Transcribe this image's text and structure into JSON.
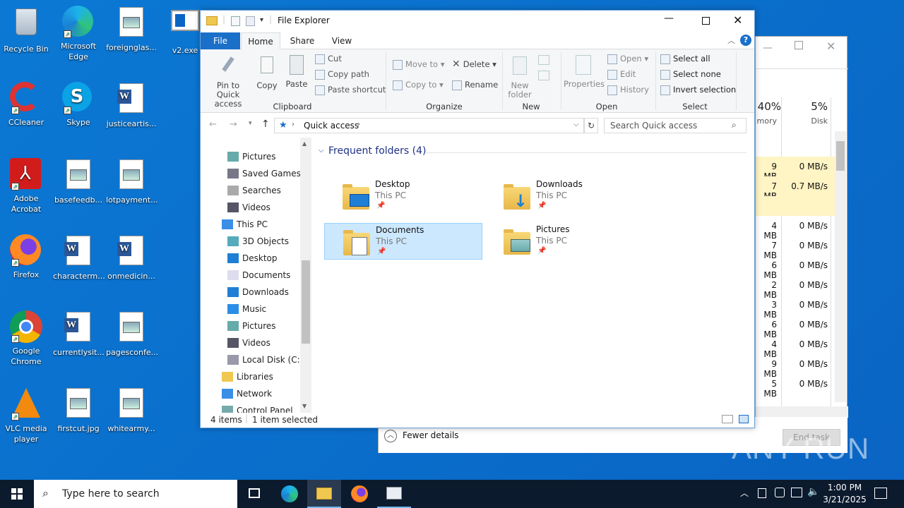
{
  "desktop": {
    "icons": [
      {
        "label": "Recycle Bin"
      },
      {
        "label": "Microsoft Edge"
      },
      {
        "label": "foreignglas..."
      },
      {
        "label": "v2.exe"
      },
      {
        "label": "CCleaner"
      },
      {
        "label": "Skype"
      },
      {
        "label": "justiceartis..."
      },
      {
        "label": "Adobe Acrobat"
      },
      {
        "label": "basefeedb..."
      },
      {
        "label": "lotpayment..."
      },
      {
        "label": "Firefox"
      },
      {
        "label": "characterm..."
      },
      {
        "label": "onmedicin..."
      },
      {
        "label": "Google Chrome"
      },
      {
        "label": "currentlysit..."
      },
      {
        "label": "pagesconfe..."
      },
      {
        "label": "VLC media player"
      },
      {
        "label": "firstcut.jpg"
      },
      {
        "label": "whitearmy..."
      }
    ]
  },
  "taskmgr": {
    "memory_pct": "40%",
    "memory_label": "mory",
    "disk_pct": "5%",
    "disk_label": "Disk",
    "rows": [
      {
        "mem": "9 MB",
        "disk": "0 MB/s"
      },
      {
        "mem": "7 MB",
        "disk": "0.7 MB/s"
      },
      {
        "mem": "",
        "disk": ""
      },
      {
        "mem": "4 MB",
        "disk": "0 MB/s"
      },
      {
        "mem": "7 MB",
        "disk": "0 MB/s"
      },
      {
        "mem": "6 MB",
        "disk": "0 MB/s"
      },
      {
        "mem": "2 MB",
        "disk": "0 MB/s"
      },
      {
        "mem": "3 MB",
        "disk": "0 MB/s"
      },
      {
        "mem": "6 MB",
        "disk": "0 MB/s"
      },
      {
        "mem": "4 MB",
        "disk": "0 MB/s"
      },
      {
        "mem": "9 MB",
        "disk": "0 MB/s"
      },
      {
        "mem": "5 MB",
        "disk": "0 MB/s"
      }
    ],
    "fewer_details": "Fewer details",
    "end_task": "End task"
  },
  "explorer": {
    "title": "File Explorer",
    "tabs": [
      "File",
      "Home",
      "Share",
      "View"
    ],
    "clipboard": {
      "pin": "Pin to Quick access",
      "copy": "Copy",
      "paste": "Paste",
      "cut": "Cut",
      "copy_path": "Copy path",
      "paste_shortcut": "Paste shortcut",
      "group": "Clipboard"
    },
    "organize": {
      "move_to": "Move to",
      "copy_to": "Copy to",
      "delete": "Delete",
      "rename": "Rename",
      "group": "Organize"
    },
    "new": {
      "new_folder": "New folder",
      "group": "New"
    },
    "open": {
      "properties": "Properties",
      "open": "Open",
      "edit": "Edit",
      "history": "History",
      "group": "Open"
    },
    "select": {
      "select_all": "Select all",
      "select_none": "Select none",
      "invert": "Invert selection",
      "group": "Select"
    },
    "address": "Quick access",
    "search_placeholder": "Search Quick access",
    "nav": [
      {
        "label": "Pictures",
        "icon": "pictures-icon"
      },
      {
        "label": "Saved Games",
        "icon": "saved-games-icon"
      },
      {
        "label": "Searches",
        "icon": "searches-icon"
      },
      {
        "label": "Videos",
        "icon": "videos-icon"
      },
      {
        "label": "This PC",
        "icon": "this-pc-icon"
      },
      {
        "label": "3D Objects",
        "icon": "3d-objects-icon"
      },
      {
        "label": "Desktop",
        "icon": "desktop-icon"
      },
      {
        "label": "Documents",
        "icon": "documents-icon"
      },
      {
        "label": "Downloads",
        "icon": "downloads-icon"
      },
      {
        "label": "Music",
        "icon": "music-icon"
      },
      {
        "label": "Pictures",
        "icon": "pictures-icon"
      },
      {
        "label": "Videos",
        "icon": "videos-icon"
      },
      {
        "label": "Local Disk (C:)",
        "icon": "local-disk-icon"
      },
      {
        "label": "Libraries",
        "icon": "libraries-icon"
      },
      {
        "label": "Network",
        "icon": "network-icon"
      },
      {
        "label": "Control Panel",
        "icon": "control-panel-icon"
      }
    ],
    "frequent_header": "Frequent folders (4)",
    "folders": [
      {
        "name": "Desktop",
        "location": "This PC"
      },
      {
        "name": "Downloads",
        "location": "This PC"
      },
      {
        "name": "Documents",
        "location": "This PC"
      },
      {
        "name": "Pictures",
        "location": "This PC"
      }
    ],
    "status_items": "4 items",
    "status_selected": "1 item selected"
  },
  "taskbar": {
    "search_placeholder": "Type here to search",
    "time": "1:00 PM",
    "date": "3/21/2025"
  },
  "watermark": "ANY RUN"
}
